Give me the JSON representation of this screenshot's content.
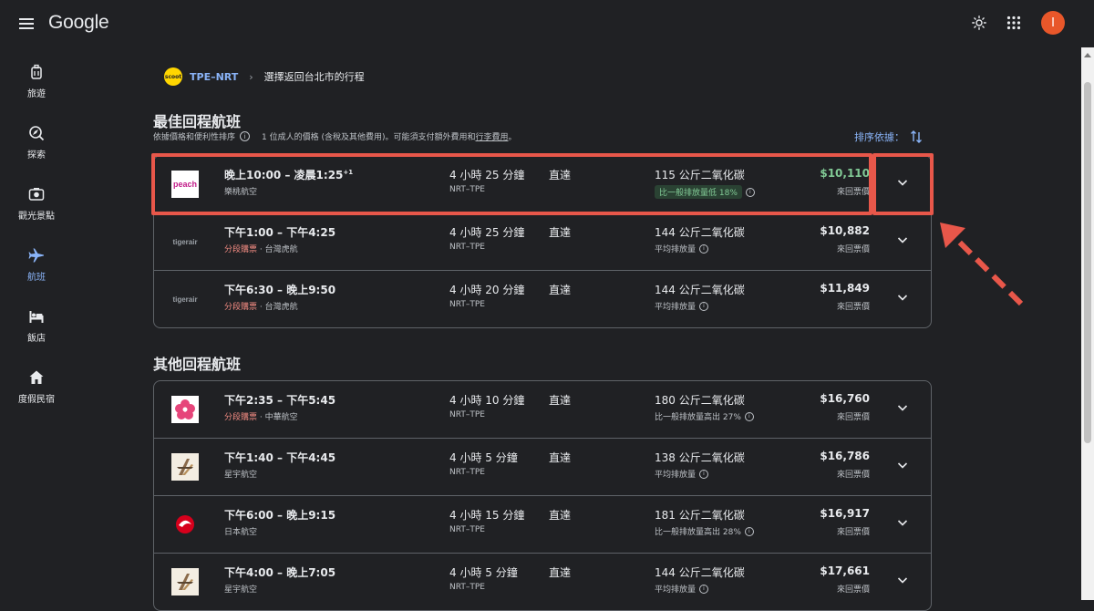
{
  "app": {
    "logo": "Google",
    "avatar_letter": "I",
    "accent": "#8ab4f8",
    "highlight_color": "#e8574a"
  },
  "sidebar": {
    "items": [
      {
        "label": "旅遊",
        "icon": "luggage-icon"
      },
      {
        "label": "探索",
        "icon": "explore-icon"
      },
      {
        "label": "觀光景點",
        "icon": "camera-icon"
      },
      {
        "label": "航班",
        "icon": "flight-icon",
        "active": true
      },
      {
        "label": "飯店",
        "icon": "hotel-icon"
      },
      {
        "label": "度假民宿",
        "icon": "home-icon"
      }
    ]
  },
  "breadcrumb": {
    "airline_badge": "scoot",
    "route": "TPE–NRT",
    "step": "選擇返回台北市的行程"
  },
  "best": {
    "title": "最佳回程航班",
    "subtitle": "依據價格和便利性排序",
    "subtitle_note_pre": "1 位成人的價格 (含稅及其他費用)。可能須支付額外費用和",
    "subtitle_link": "行李費用",
    "subtitle_note_post": "。",
    "sort_label": "排序依據：",
    "flights": [
      {
        "logo": "peach",
        "time": "晚上10:00 – 凌晨1:25",
        "day_offset": "+1",
        "segment": "",
        "airline": "樂桃航空",
        "duration": "4 小時 25 分鐘",
        "route": "NRT–TPE",
        "stops": "直達",
        "co2": "115 公斤二氧化碳",
        "co2_note": "比一般排放量低 18%",
        "co2_chip": true,
        "price": "$10,110",
        "price_green": true,
        "price_type": "來回票價"
      },
      {
        "logo": "tigerair",
        "time": "下午1:00 – 下午4:25",
        "day_offset": "",
        "segment": "分段購票",
        "airline": "台灣虎航",
        "duration": "4 小時 25 分鐘",
        "route": "NRT–TPE",
        "stops": "直達",
        "co2": "144 公斤二氧化碳",
        "co2_note": "平均排放量",
        "co2_chip": false,
        "price": "$10,882",
        "price_green": false,
        "price_type": "來回票價"
      },
      {
        "logo": "tigerair",
        "time": "下午6:30 – 晚上9:50",
        "day_offset": "",
        "segment": "分段購票",
        "airline": "台灣虎航",
        "duration": "4 小時 20 分鐘",
        "route": "NRT–TPE",
        "stops": "直達",
        "co2": "144 公斤二氧化碳",
        "co2_note": "平均排放量",
        "co2_chip": false,
        "price": "$11,849",
        "price_green": false,
        "price_type": "來回票價"
      }
    ]
  },
  "other": {
    "title": "其他回程航班",
    "flights": [
      {
        "logo": "china-airlines",
        "time": "下午2:35 – 下午5:45",
        "day_offset": "",
        "segment": "分段購票",
        "airline": "中華航空",
        "duration": "4 小時 10 分鐘",
        "route": "NRT–TPE",
        "stops": "直達",
        "co2": "180 公斤二氧化碳",
        "co2_note": "比一般排放量高出 27%",
        "co2_chip": false,
        "price": "$16,760",
        "price_green": false,
        "price_type": "來回票價"
      },
      {
        "logo": "starlux",
        "time": "下午1:40 – 下午4:45",
        "day_offset": "",
        "segment": "",
        "airline": "星宇航空",
        "duration": "4 小時 5 分鐘",
        "route": "NRT–TPE",
        "stops": "直達",
        "co2": "138 公斤二氧化碳",
        "co2_note": "平均排放量",
        "co2_chip": false,
        "price": "$16,786",
        "price_green": false,
        "price_type": "來回票價"
      },
      {
        "logo": "jal",
        "time": "下午6:00 – 晚上9:15",
        "day_offset": "",
        "segment": "",
        "airline": "日本航空",
        "duration": "4 小時 15 分鐘",
        "route": "NRT–TPE",
        "stops": "直達",
        "co2": "181 公斤二氧化碳",
        "co2_note": "比一般排放量高出 28%",
        "co2_chip": false,
        "price": "$16,917",
        "price_green": false,
        "price_type": "來回票價"
      },
      {
        "logo": "starlux",
        "time": "下午4:00 – 晚上7:05",
        "day_offset": "",
        "segment": "",
        "airline": "星宇航空",
        "duration": "4 小時 5 分鐘",
        "route": "NRT–TPE",
        "stops": "直達",
        "co2": "144 公斤二氧化碳",
        "co2_note": "平均排放量",
        "co2_chip": false,
        "price": "$17,661",
        "price_green": false,
        "price_type": "來回票價"
      }
    ]
  }
}
